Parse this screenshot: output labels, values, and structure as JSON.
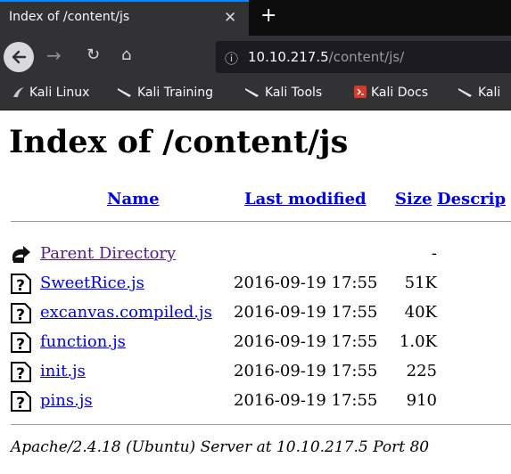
{
  "browser": {
    "tab_title": "Index of /content/js",
    "url_host": "10.10.217.5",
    "url_path": "/content/js/",
    "bookmarks": [
      "Kali Linux",
      "Kali Training",
      "Kali Tools",
      "Kali Docs",
      "Kali"
    ]
  },
  "page": {
    "heading": "Index of /content/js",
    "columns": {
      "name": "Name",
      "modified": "Last modified",
      "size": "Size",
      "description": "Descrip"
    },
    "rows": [
      {
        "name": "Parent Directory",
        "date": "",
        "size": "-",
        "icon": "back-folder-icon"
      },
      {
        "name": "SweetRice.js",
        "date": "2016-09-19 17:55",
        "size": "51K",
        "icon": "unknown-file-icon"
      },
      {
        "name": "excanvas.compiled.js",
        "date": "2016-09-19 17:55",
        "size": "40K",
        "icon": "unknown-file-icon"
      },
      {
        "name": "function.js",
        "date": "2016-09-19 17:55",
        "size": "1.0K",
        "icon": "unknown-file-icon"
      },
      {
        "name": "init.js",
        "date": "2016-09-19 17:55",
        "size": "225",
        "icon": "unknown-file-icon"
      },
      {
        "name": "pins.js",
        "date": "2016-09-19 17:55",
        "size": "910",
        "icon": "unknown-file-icon"
      }
    ],
    "address": "Apache/2.4.18 (Ubuntu) Server at 10.10.217.5 Port 80"
  },
  "colors": {
    "link": "#0000ee",
    "visited": "#551a8b",
    "chrome": "#323234",
    "accent": "#0a84ff"
  }
}
